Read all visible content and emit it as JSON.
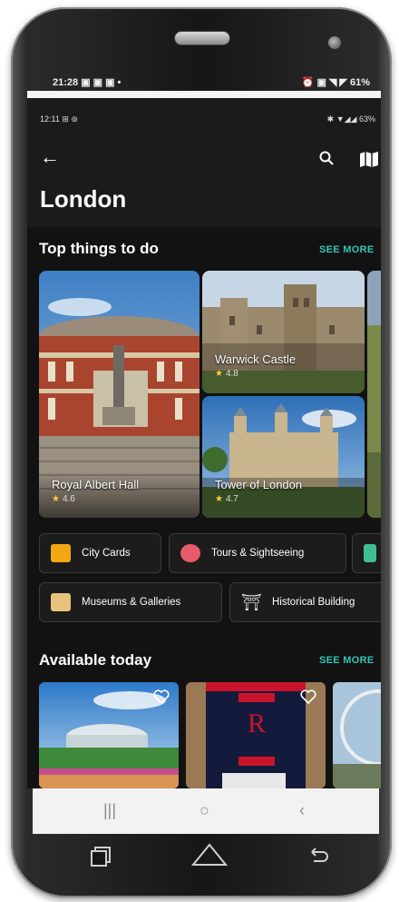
{
  "outer_status": {
    "time": "21:28",
    "left_icons": "▣ ▣ ▣ •",
    "right_icons": "⏰ ▣ ◥ ◤",
    "battery": "61%"
  },
  "inner_status": {
    "time": "12:11",
    "left_icons": "⊞ ⊚",
    "right_icons": "✱ ▼◢◢",
    "battery": "63%"
  },
  "header": {
    "back_icon": "arrow-left",
    "title": "London",
    "search_icon": "search",
    "map_icon": "map"
  },
  "section_top": {
    "title": "Top things to do",
    "see_more": "SEE MORE"
  },
  "attractions": [
    {
      "name": "Royal Albert Hall",
      "rating": "4.6"
    },
    {
      "name": "Warwick Castle",
      "rating": "4.8"
    },
    {
      "name": "Tower of London",
      "rating": "4.7"
    }
  ],
  "categories": [
    {
      "label": "City Cards",
      "icon": "city-card",
      "color": "#f3a712"
    },
    {
      "label": "Tours & Sightseeing",
      "icon": "tour-guide",
      "color": "#e85a6a"
    },
    {
      "label": "Museums & Galleries",
      "icon": "museum-frame",
      "color": "#e8c27a"
    },
    {
      "label": "Historical Building",
      "icon": "historical-building",
      "color": "#dddddd"
    }
  ],
  "section_available": {
    "title": "Available today",
    "see_more": "SEE MORE"
  },
  "colors": {
    "accent": "#2ec4b6",
    "star": "#ffcf33",
    "background": "#121212"
  },
  "nav_bar": {
    "recents": "|||",
    "home": "○",
    "back": "‹"
  }
}
